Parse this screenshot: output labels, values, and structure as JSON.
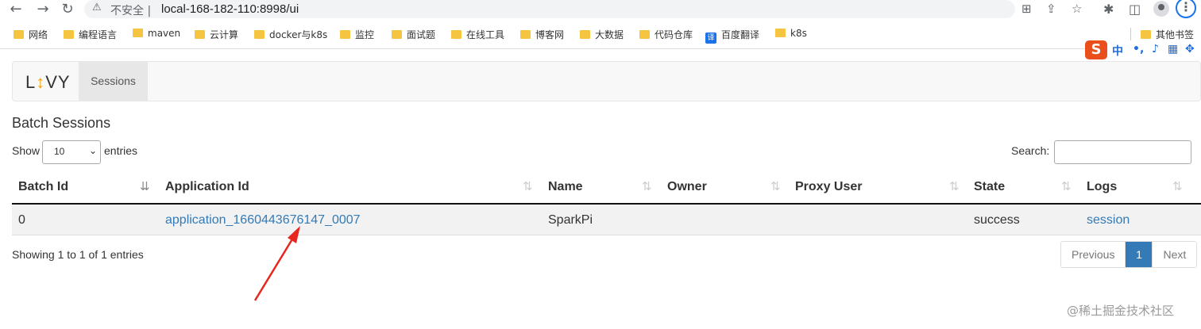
{
  "browser": {
    "back_glyph": "←",
    "forward_glyph": "→",
    "reload_glyph": "↻",
    "warning_glyph": "⚠",
    "insecure_label": "不安全 |",
    "url": "local-168-182-110:8998/ui",
    "kebab_glyph": "⋮",
    "icons": [
      "translate-icon",
      "share-icon",
      "star-icon",
      "extensions-icon",
      "side-panel-icon",
      "profile-icon",
      "menu-icon"
    ]
  },
  "bookmarks": [
    {
      "label": "网络",
      "icon": "folder-icon"
    },
    {
      "label": "编程语言",
      "icon": "folder-icon"
    },
    {
      "label": "maven",
      "icon": "folder-icon"
    },
    {
      "label": "云计算",
      "icon": "folder-icon"
    },
    {
      "label": "docker与k8s",
      "icon": "folder-icon"
    },
    {
      "label": "监控",
      "icon": "folder-icon"
    },
    {
      "label": "面试题",
      "icon": "folder-icon"
    },
    {
      "label": "在线工具",
      "icon": "folder-icon"
    },
    {
      "label": "博客网",
      "icon": "folder-icon"
    },
    {
      "label": "大数据",
      "icon": "folder-icon"
    },
    {
      "label": "代码仓库",
      "icon": "folder-icon"
    },
    {
      "label": "百度翻译",
      "icon": "baidu-translate-icon",
      "icon_text": "译"
    },
    {
      "label": "k8s",
      "icon": "folder-icon"
    }
  ],
  "other_bookmarks": "其他书签",
  "ime": {
    "logo": "S",
    "mode": "中",
    "punct": "•,",
    "icons": [
      "mic-icon",
      "keyboard-icon",
      "grid-icon"
    ]
  },
  "navbar": {
    "brand_pre": "L",
    "brand_mark": "↕",
    "brand_post": "VY",
    "item": "Sessions"
  },
  "page": {
    "title": "Batch Sessions",
    "show": "Show",
    "page_size": "10",
    "entries": "entries",
    "search_label": "Search:",
    "search_value": ""
  },
  "table": {
    "columns": [
      "Batch Id",
      "Application Id",
      "Name",
      "Owner",
      "Proxy User",
      "State",
      "Logs"
    ],
    "sort_glyph": "⇅",
    "sort_active_glyph": "⇊",
    "rows": [
      {
        "batch_id": "0",
        "app_id": "application_1660443676147_0007",
        "name": "SparkPi",
        "owner": "",
        "proxy_user": "",
        "state": "success",
        "logs": "session"
      }
    ]
  },
  "footer": {
    "info": "Showing 1 to 1 of 1 entries",
    "prev": "Previous",
    "page": "1",
    "next": "Next"
  },
  "watermark": "@稀土掘金技术社区",
  "colors": {
    "link": "#337ab7",
    "active_page": "#337ab7",
    "annotation_arrow": "#e8261d"
  }
}
